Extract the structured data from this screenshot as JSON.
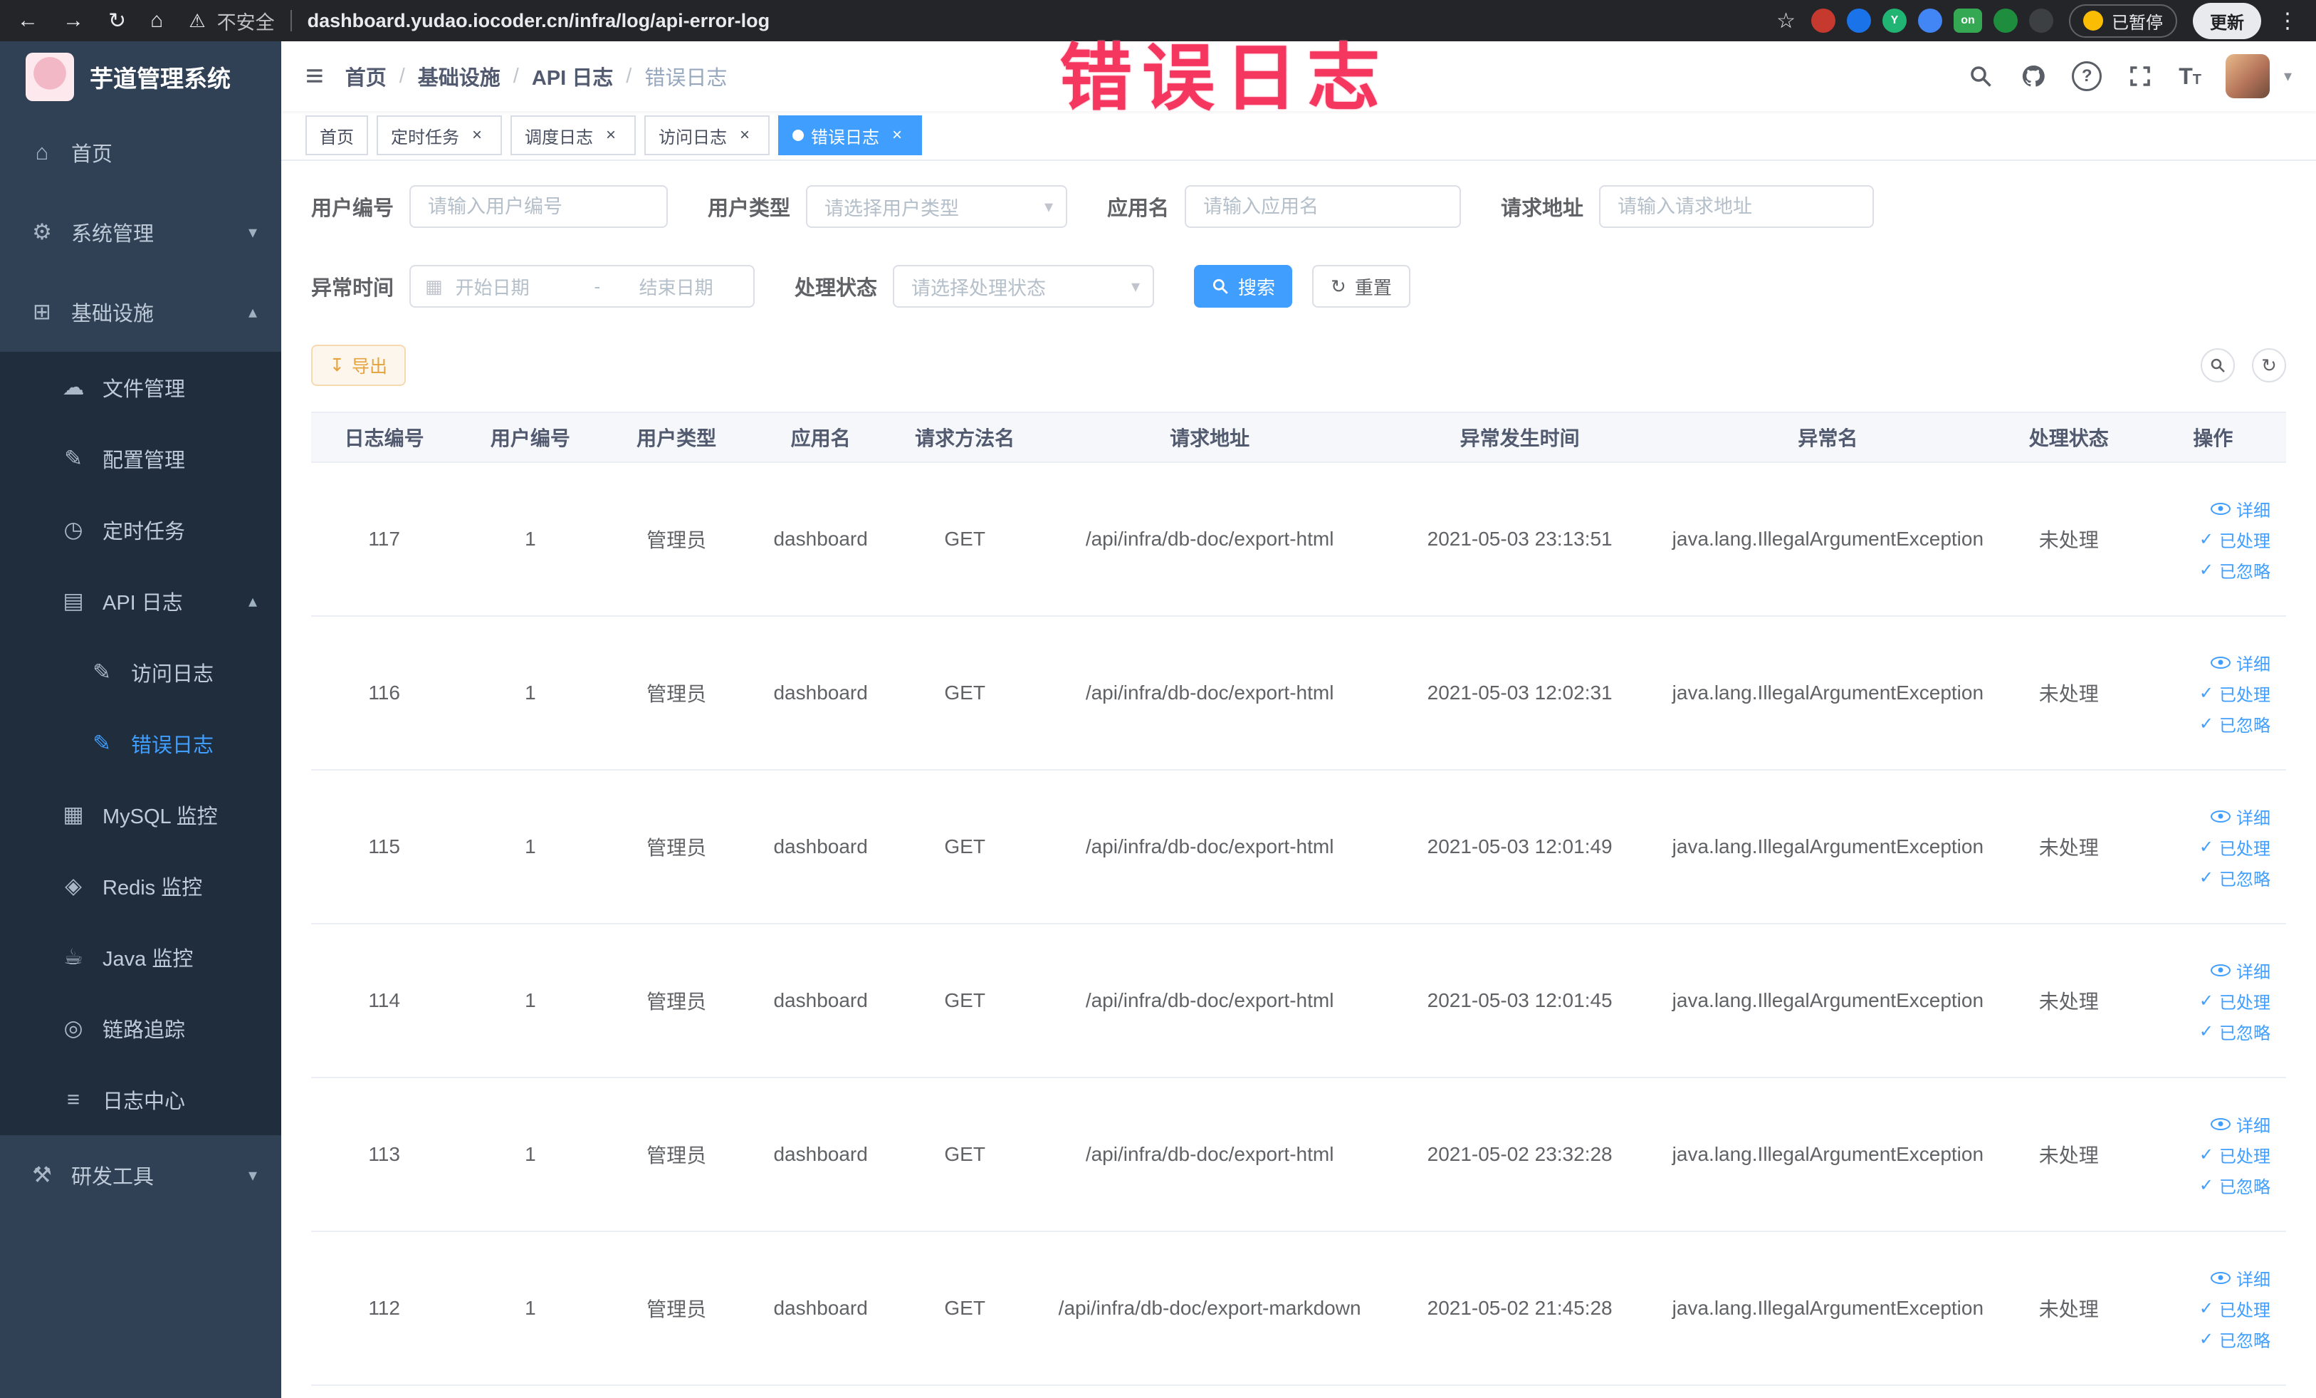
{
  "browser": {
    "security_label": "不安全",
    "url": "dashboard.yudao.iocoder.cn/infra/log/api-error-log",
    "paused_badge": "已暂停",
    "update_button": "更新",
    "extensions": [
      {
        "name": "extension-red",
        "color": "#c5392f",
        "glyph": ""
      },
      {
        "name": "extension-blue-drop",
        "color": "#1a73e8",
        "glyph": ""
      },
      {
        "name": "extension-green-y",
        "color": "#21b573",
        "glyph": "Y"
      },
      {
        "name": "extension-blue-grid",
        "color": "#4285f4",
        "glyph": ""
      },
      {
        "name": "extension-green-on",
        "color": "#34a853",
        "glyph": "on"
      },
      {
        "name": "extension-leaf",
        "color": "#1e8e3e",
        "glyph": ""
      },
      {
        "name": "extension-dark-paw",
        "color": "#3c4043",
        "glyph": ""
      }
    ]
  },
  "annotation": "错误日志",
  "sidebar": {
    "logo_title": "芋道管理系统",
    "items": [
      {
        "id": "home",
        "label": "首页",
        "level": 1,
        "icon": "home-icon",
        "glyph": "⌂"
      },
      {
        "id": "system",
        "label": "系统管理",
        "level": 1,
        "icon": "gear-icon",
        "glyph": "⚙",
        "arrow": "down"
      },
      {
        "id": "infra",
        "label": "基础设施",
        "level": 1,
        "icon": "infra-icon",
        "glyph": "⊞",
        "arrow": "up"
      },
      {
        "id": "file-manage",
        "label": "文件管理",
        "level": 2,
        "icon": "file-icon",
        "glyph": "☁"
      },
      {
        "id": "config-manage",
        "label": "配置管理",
        "level": 2,
        "icon": "config-icon",
        "glyph": "✎"
      },
      {
        "id": "scheduled-job",
        "label": "定时任务",
        "level": 2,
        "icon": "timer-icon",
        "glyph": "◷"
      },
      {
        "id": "api-log",
        "label": "API 日志",
        "level": 2,
        "icon": "api-log-icon",
        "glyph": "▤",
        "arrow": "up"
      },
      {
        "id": "access-log",
        "label": "访问日志",
        "level": 3,
        "icon": "access-log-icon",
        "glyph": "✎"
      },
      {
        "id": "error-log",
        "label": "错误日志",
        "level": 3,
        "icon": "error-log-icon",
        "glyph": "✎",
        "active": true
      },
      {
        "id": "mysql-monitor",
        "label": "MySQL 监控",
        "level": 2,
        "icon": "mysql-icon",
        "glyph": "▦"
      },
      {
        "id": "redis-monitor",
        "label": "Redis 监控",
        "level": 2,
        "icon": "redis-icon",
        "glyph": "◈"
      },
      {
        "id": "java-monitor",
        "label": "Java 监控",
        "level": 2,
        "icon": "java-icon",
        "glyph": "☕"
      },
      {
        "id": "link-trace",
        "label": "链路追踪",
        "level": 2,
        "icon": "trace-icon",
        "glyph": "◎"
      },
      {
        "id": "log-center",
        "label": "日志中心",
        "level": 2,
        "icon": "log-center-icon",
        "glyph": "≡"
      },
      {
        "id": "dev-tools",
        "label": "研发工具",
        "level": 1,
        "icon": "tools-icon",
        "glyph": "⚒",
        "arrow": "down"
      }
    ]
  },
  "header": {
    "breadcrumbs": [
      "首页",
      "基础设施",
      "API 日志",
      "错误日志"
    ]
  },
  "tabs": [
    {
      "label": "首页",
      "closable": false,
      "active": false
    },
    {
      "label": "定时任务",
      "closable": true,
      "active": false
    },
    {
      "label": "调度日志",
      "closable": true,
      "active": false
    },
    {
      "label": "访问日志",
      "closable": true,
      "active": false
    },
    {
      "label": "错误日志",
      "closable": true,
      "active": true
    }
  ],
  "filters": {
    "user_id": {
      "label": "用户编号",
      "placeholder": "请输入用户编号"
    },
    "user_type": {
      "label": "用户类型",
      "placeholder": "请选择用户类型"
    },
    "app_name": {
      "label": "应用名",
      "placeholder": "请输入应用名"
    },
    "request_url": {
      "label": "请求地址",
      "placeholder": "请输入请求地址"
    },
    "exception_time": {
      "label": "异常时间",
      "start_placeholder": "开始日期",
      "separator": "-",
      "end_placeholder": "结束日期"
    },
    "process_status": {
      "label": "处理状态",
      "placeholder": "请选择处理状态"
    },
    "search_button": "搜索",
    "reset_button": "重置"
  },
  "toolbar": {
    "export_button": "导出"
  },
  "table": {
    "columns": [
      "日志编号",
      "用户编号",
      "用户类型",
      "应用名",
      "请求方法名",
      "请求地址",
      "异常发生时间",
      "异常名",
      "处理状态",
      "操作"
    ],
    "actions": [
      {
        "name": "detail",
        "label": "详细",
        "icon": "eye"
      },
      {
        "name": "processed",
        "label": "已处理",
        "icon": "check"
      },
      {
        "name": "ignored",
        "label": "已忽略",
        "icon": "check"
      }
    ],
    "rows": [
      [
        "117",
        "1",
        "管理员",
        "dashboard",
        "GET",
        "/api/infra/db-doc/export-html",
        "2021-05-03 23:13:51",
        "java.lang.IllegalArgumentException",
        "未处理"
      ],
      [
        "116",
        "1",
        "管理员",
        "dashboard",
        "GET",
        "/api/infra/db-doc/export-html",
        "2021-05-03 12:02:31",
        "java.lang.IllegalArgumentException",
        "未处理"
      ],
      [
        "115",
        "1",
        "管理员",
        "dashboard",
        "GET",
        "/api/infra/db-doc/export-html",
        "2021-05-03 12:01:49",
        "java.lang.IllegalArgumentException",
        "未处理"
      ],
      [
        "114",
        "1",
        "管理员",
        "dashboard",
        "GET",
        "/api/infra/db-doc/export-html",
        "2021-05-03 12:01:45",
        "java.lang.IllegalArgumentException",
        "未处理"
      ],
      [
        "113",
        "1",
        "管理员",
        "dashboard",
        "GET",
        "/api/infra/db-doc/export-html",
        "2021-05-02 23:32:28",
        "java.lang.IllegalArgumentException",
        "未处理"
      ],
      [
        "112",
        "1",
        "管理员",
        "dashboard",
        "GET",
        "/api/infra/db-doc/export-markdown",
        "2021-05-02 21:45:28",
        "java.lang.IllegalArgumentException",
        "未处理"
      ]
    ]
  },
  "colors": {
    "accent": "#409eff",
    "warning": "#e6a23c",
    "annotation_red": "#f5365f",
    "sidebar_bg": "#304156",
    "submenu_bg": "#1f2d3d"
  }
}
